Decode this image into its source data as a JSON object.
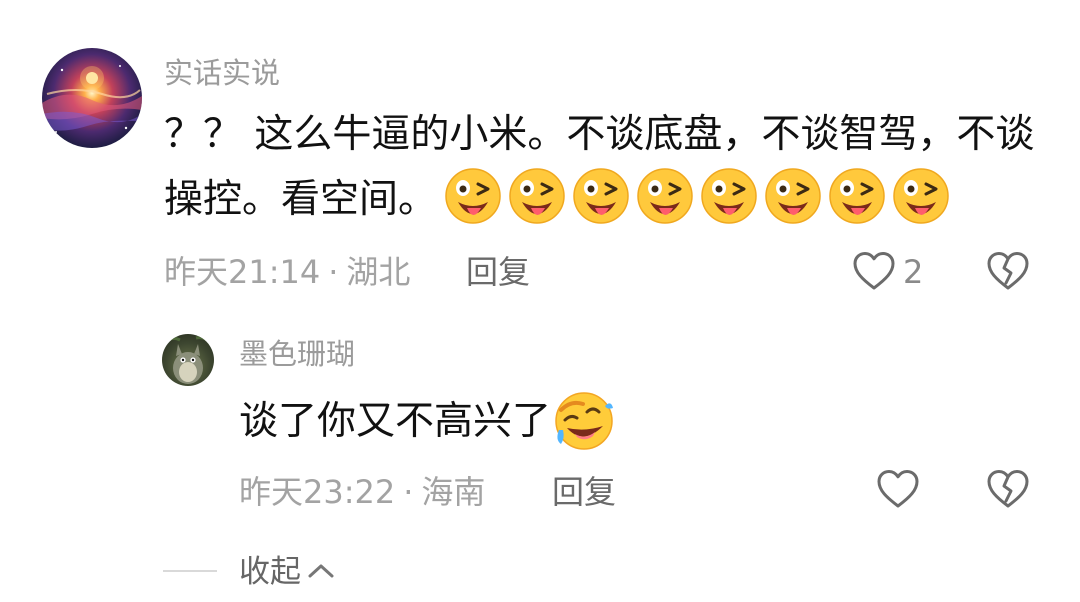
{
  "comment": {
    "username": "实话实说",
    "text": "？？ 这么牛逼的小米。不谈底盘，不谈智驾，不谈操控。看空间。",
    "emoji_icon": "squinting-tongue-emoji",
    "emoji_count": 8,
    "time": "昨天21:14",
    "separator": "·",
    "location": "湖北",
    "reply_label": "回复",
    "like_count": "2"
  },
  "reply": {
    "username": "墨色珊瑚",
    "text": "谈了你又不高兴了",
    "emoji_icon": "rolling-laughing-emoji",
    "time": "昨天23:22",
    "separator": "·",
    "location": "海南",
    "reply_label": "回复"
  },
  "collapse": {
    "label": "收起"
  }
}
